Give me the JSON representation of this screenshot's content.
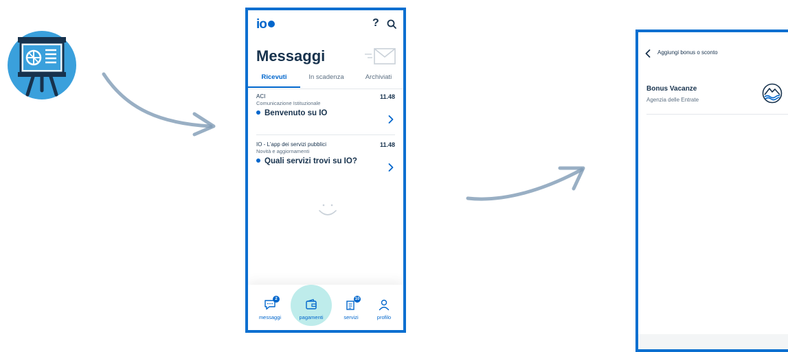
{
  "phone1": {
    "logo": "io",
    "help_glyph": "?",
    "title": "Messaggi",
    "tabs": [
      {
        "label": "Ricevuti"
      },
      {
        "label": "In scadenza"
      },
      {
        "label": "Archiviati"
      }
    ],
    "messages": [
      {
        "sender": "ACI",
        "description": "Comunicazione Istituzionale",
        "time": "11.48",
        "subject": "Benvenuto su IO"
      },
      {
        "sender": "IO - L'app dei servizi pubblici",
        "description": "Novità e aggiornamenti",
        "time": "11.48",
        "subject": "Quali servizi trovi su IO?"
      }
    ],
    "nav": [
      {
        "label": "messaggi",
        "badge": "2"
      },
      {
        "label": "pagamenti"
      },
      {
        "label": "servizi",
        "badge": "10"
      },
      {
        "label": "profilo"
      }
    ]
  },
  "phone2": {
    "header_title": "Aggiungi bonus o sconto",
    "item_title": "Bonus Vacanze",
    "item_subtitle": "Agenzia delle Entrate"
  },
  "colors": {
    "accent": "#0066cc",
    "frame": "#0a6fd0",
    "text": "#17324d",
    "highlight": "#a8e6e4"
  },
  "icons": [
    "presentation-icon",
    "arrow-icon",
    "help-icon",
    "search-icon",
    "envelope-icon",
    "chevron-right-icon",
    "smiley-icon",
    "chat-icon",
    "wallet-icon",
    "services-icon",
    "profile-icon",
    "back-icon",
    "bonus-logo-icon"
  ]
}
